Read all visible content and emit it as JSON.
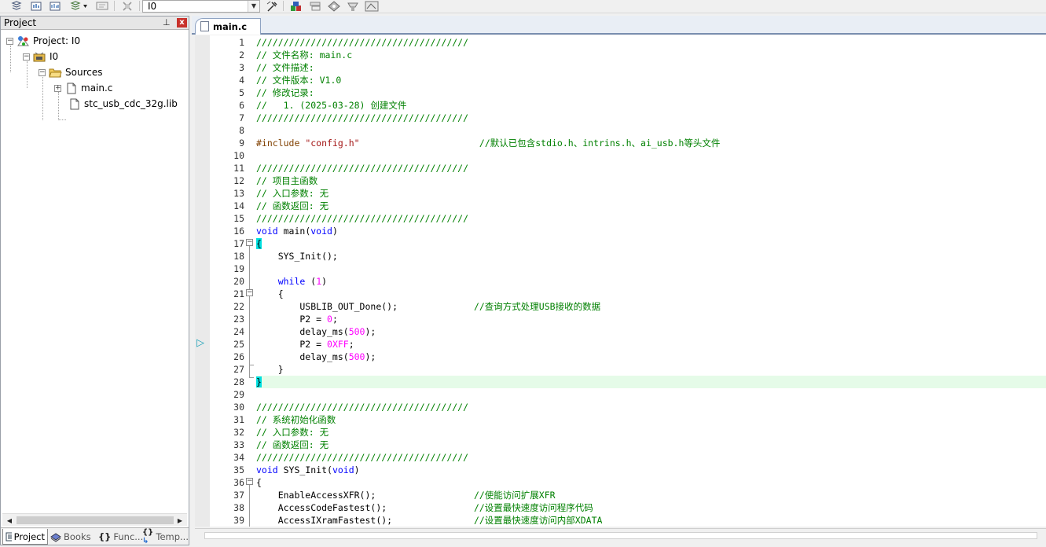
{
  "toolbar": {
    "target": "I0",
    "icons": [
      "stack-icon",
      "build-icon",
      "rebuild-icon",
      "batch-build-icon",
      "download-icon",
      "stop-icon",
      "target-options-icon",
      "manage-components-icon",
      "select-packs-icon",
      "pack-installer-icon",
      "manage-run-time-icon",
      "manage-rte-icon"
    ]
  },
  "project_panel": {
    "title": "Project",
    "pin": "📌",
    "close": "x",
    "tree": {
      "project": "Project: I0",
      "target": "I0",
      "group": "Sources",
      "files": [
        "main.c",
        "stc_usb_cdc_32g.lib"
      ]
    },
    "tabs": [
      "Project",
      "Books",
      "Func...",
      "Temp..."
    ],
    "tab_icons": [
      "project-tab-icon",
      "books-tab-icon",
      "functions-tab-icon",
      "templates-tab-icon"
    ],
    "tab_glyphs": [
      "",
      "",
      "{}",
      "{}"
    ]
  },
  "editor": {
    "tab_label": "main.c",
    "lines": [
      {
        "n": "1",
        "t": [
          [
            "c-com",
            "///////////////////////////////////////"
          ]
        ]
      },
      {
        "n": "2",
        "t": [
          [
            "c-com",
            "// 文件名称: main.c"
          ]
        ]
      },
      {
        "n": "3",
        "t": [
          [
            "c-com",
            "// 文件描述:"
          ]
        ]
      },
      {
        "n": "4",
        "t": [
          [
            "c-com",
            "// 文件版本: V1.0"
          ]
        ]
      },
      {
        "n": "5",
        "t": [
          [
            "c-com",
            "// 修改记录:"
          ]
        ]
      },
      {
        "n": "6",
        "t": [
          [
            "c-com",
            "//   1. (2025-03-28) 创建文件"
          ]
        ]
      },
      {
        "n": "7",
        "t": [
          [
            "c-com",
            "///////////////////////////////////////"
          ]
        ]
      },
      {
        "n": "8",
        "t": []
      },
      {
        "n": "9",
        "t": [
          [
            "c-pp",
            "#include "
          ],
          [
            "c-str",
            "\"config.h\""
          ],
          [
            "",
            "                      "
          ],
          [
            "c-com",
            "//默认已包含stdio.h、intrins.h、ai_usb.h等头文件"
          ]
        ]
      },
      {
        "n": "10",
        "t": []
      },
      {
        "n": "11",
        "t": [
          [
            "c-com",
            "///////////////////////////////////////"
          ]
        ]
      },
      {
        "n": "12",
        "t": [
          [
            "c-com",
            "// 项目主函数"
          ]
        ]
      },
      {
        "n": "13",
        "t": [
          [
            "c-com",
            "// 入口参数: 无"
          ]
        ]
      },
      {
        "n": "14",
        "t": [
          [
            "c-com",
            "// 函数返回: 无"
          ]
        ]
      },
      {
        "n": "15",
        "t": [
          [
            "c-com",
            "///////////////////////////////////////"
          ]
        ]
      },
      {
        "n": "16",
        "t": [
          [
            "c-kw",
            "void"
          ],
          [
            "",
            " main("
          ],
          [
            "c-kw",
            "void"
          ],
          [
            "",
            ")"
          ]
        ]
      },
      {
        "n": "17",
        "t": [
          [
            "c-brace",
            "{"
          ]
        ]
      },
      {
        "n": "18",
        "t": [
          [
            "",
            "    SYS_Init();"
          ]
        ]
      },
      {
        "n": "19",
        "t": []
      },
      {
        "n": "20",
        "t": [
          [
            "",
            "    "
          ],
          [
            "c-kw",
            "while"
          ],
          [
            "",
            " ("
          ],
          [
            "c-num",
            "1"
          ],
          [
            "",
            ")"
          ]
        ]
      },
      {
        "n": "21",
        "t": [
          [
            "",
            "    {"
          ]
        ]
      },
      {
        "n": "22",
        "t": [
          [
            "",
            "        USBLIB_OUT_Done();              "
          ],
          [
            "c-com",
            "//查询方式处理USB接收的数据"
          ]
        ]
      },
      {
        "n": "23",
        "t": [
          [
            "",
            "        P2 = "
          ],
          [
            "c-num",
            "0"
          ],
          [
            "",
            ";"
          ]
        ]
      },
      {
        "n": "24",
        "t": [
          [
            "",
            "        delay_ms("
          ],
          [
            "c-num",
            "500"
          ],
          [
            "",
            ");"
          ]
        ]
      },
      {
        "n": "25",
        "t": [
          [
            "",
            "        P2 = "
          ],
          [
            "c-num",
            "0XFF"
          ],
          [
            "",
            ";"
          ]
        ]
      },
      {
        "n": "26",
        "t": [
          [
            "",
            "        delay_ms("
          ],
          [
            "c-num",
            "500"
          ],
          [
            "",
            ");"
          ]
        ]
      },
      {
        "n": "27",
        "t": [
          [
            "",
            "    }"
          ]
        ]
      },
      {
        "n": "28",
        "t": [
          [
            "c-brace",
            "}"
          ]
        ],
        "hl": true
      },
      {
        "n": "29",
        "t": []
      },
      {
        "n": "30",
        "t": [
          [
            "c-com",
            "///////////////////////////////////////"
          ]
        ]
      },
      {
        "n": "31",
        "t": [
          [
            "c-com",
            "// 系统初始化函数"
          ]
        ]
      },
      {
        "n": "32",
        "t": [
          [
            "c-com",
            "// 入口参数: 无"
          ]
        ]
      },
      {
        "n": "33",
        "t": [
          [
            "c-com",
            "// 函数返回: 无"
          ]
        ]
      },
      {
        "n": "34",
        "t": [
          [
            "c-com",
            "///////////////////////////////////////"
          ]
        ]
      },
      {
        "n": "35",
        "t": [
          [
            "c-kw",
            "void"
          ],
          [
            "",
            " SYS_Init("
          ],
          [
            "c-kw",
            "void"
          ],
          [
            "",
            ")"
          ]
        ]
      },
      {
        "n": "36",
        "t": [
          [
            "",
            "{"
          ]
        ]
      },
      {
        "n": "37",
        "t": [
          [
            "",
            "    EnableAccessXFR();                  "
          ],
          [
            "c-com",
            "//使能访问扩展XFR"
          ]
        ]
      },
      {
        "n": "38",
        "t": [
          [
            "",
            "    AccessCodeFastest();                "
          ],
          [
            "c-com",
            "//设置最快速度访问程序代码"
          ]
        ]
      },
      {
        "n": "39",
        "t": [
          [
            "",
            "    AccessIXramFastest();               "
          ],
          [
            "c-com",
            "//设置最快速度访问内部XDATA"
          ]
        ]
      }
    ]
  }
}
